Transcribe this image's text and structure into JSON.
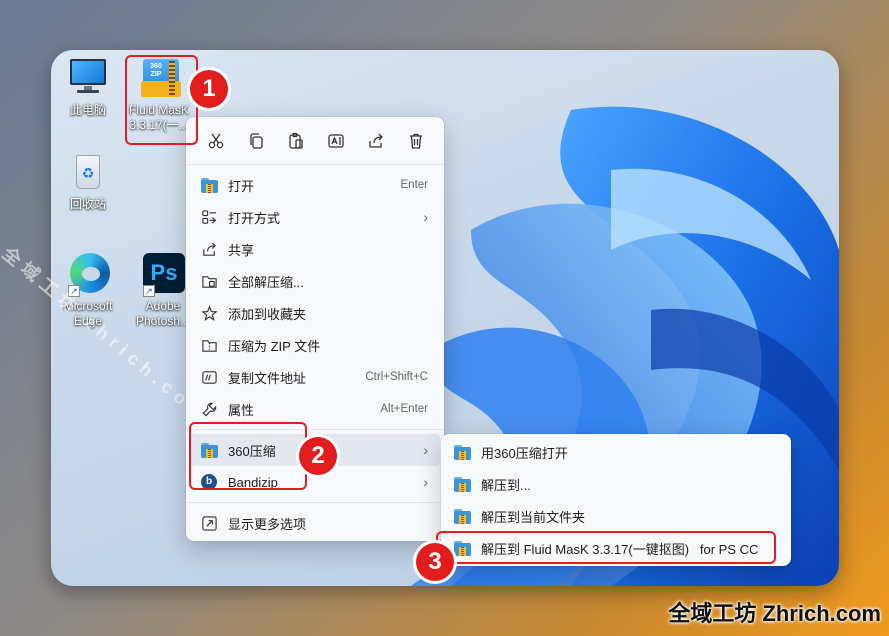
{
  "desktop_icons": [
    {
      "label": "此电脑",
      "icon": "computer-icon"
    },
    {
      "label": "回收站",
      "icon": "recycle-bin-icon"
    },
    {
      "label": "Microsoft\nEdge",
      "icon": "edge-icon"
    },
    {
      "label": "Fluid MasK\n3.3.17(一...",
      "icon": "zip-archive-icon",
      "badge": "360\nZIP"
    },
    {
      "label": "Adobe\nPhotosh...",
      "icon": "photoshop-icon",
      "badge": "Ps"
    }
  ],
  "toolbar": [
    {
      "name": "cut",
      "icon": "scissors-icon"
    },
    {
      "name": "copy",
      "icon": "copy-icon"
    },
    {
      "name": "paste",
      "icon": "paste-icon"
    },
    {
      "name": "rename",
      "icon": "rename-icon"
    },
    {
      "name": "share",
      "icon": "share-icon"
    },
    {
      "name": "delete",
      "icon": "trash-icon"
    }
  ],
  "menu": {
    "items": [
      {
        "label": "打开",
        "shortcut": "Enter",
        "icon": "folder-zip-icon"
      },
      {
        "label": "打开方式",
        "arrow": "›",
        "icon": "open-with-icon"
      },
      {
        "label": "共享",
        "icon": "share-icon"
      },
      {
        "label": "全部解压缩...",
        "icon": "extract-all-icon"
      },
      {
        "label": "添加到收藏夹",
        "icon": "star-icon"
      },
      {
        "label": "压缩为 ZIP 文件",
        "icon": "zip-file-icon"
      },
      {
        "label": "复制文件地址",
        "shortcut": "Ctrl+Shift+C",
        "icon": "copy-path-icon"
      },
      {
        "label": "属性",
        "shortcut": "Alt+Enter",
        "icon": "wrench-icon"
      },
      {
        "label": "360压缩",
        "arrow": "›",
        "icon": "360-zip-icon"
      },
      {
        "label": "Bandizip",
        "arrow": "›",
        "icon": "bandizip-icon"
      },
      {
        "label": "显示更多选项",
        "icon": "more-options-icon"
      }
    ]
  },
  "submenu": {
    "items": [
      {
        "label": "用360压缩打开"
      },
      {
        "label": "解压到..."
      },
      {
        "label": "解压到当前文件夹"
      },
      {
        "label": "解压到 Fluid MasK 3.3.17(一键抠图)   for PS CC"
      }
    ]
  },
  "annotations": {
    "step1": "1",
    "step2": "2",
    "step3": "3"
  },
  "watermarks": {
    "diagonal": "全域工坊 zhrich.com",
    "corner": "全域工坊 Zhrich.com"
  },
  "colors": {
    "annotation": "#e11d1d",
    "accent": "#0067c0"
  }
}
